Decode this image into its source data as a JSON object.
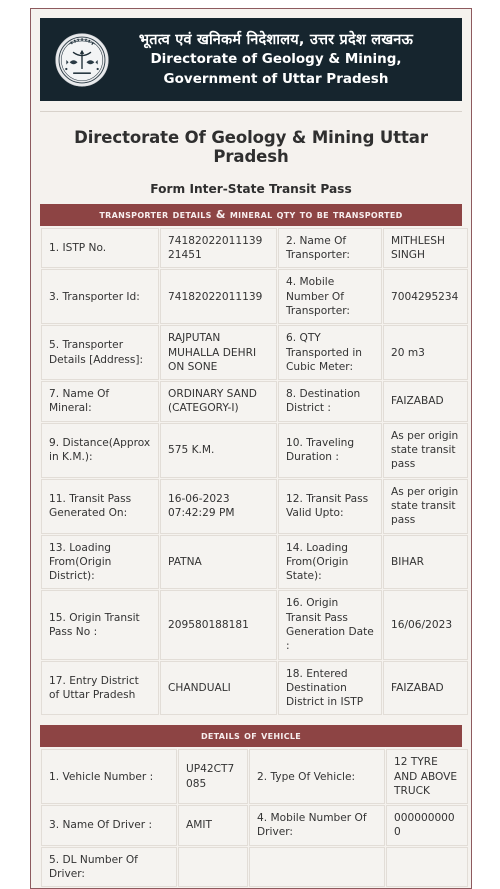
{
  "banner": {
    "emblem_icon": "uttar-pradesh-state-emblem-icon",
    "hindi_title": "भूतत्व एवं खनिकर्म निदेशालय, उत्तर प्रदेश लखनऊ",
    "english_line1": "Directorate of Geology & Mining,",
    "english_line2": "Government of Uttar Pradesh",
    "background_color": "#16252e"
  },
  "header": {
    "main_title": "Directorate Of Geology & Mining Uttar Pradesh",
    "sub_title": "Form Inter-State Transit Pass"
  },
  "colors": {
    "section_bar": "#8d4444",
    "card_border": "#8d5a5e",
    "card_background": "#f5f2ee",
    "cell_background": "#f5f3f0"
  },
  "transporter_section": {
    "bar_label": "Transporter Details & Mineral QTY to be Transported",
    "rows": [
      {
        "label_left": "1. ISTP No.",
        "value_left": "7418202201113921451",
        "label_right": "2. Name Of Transporter:",
        "value_right": "MITHLESH SINGH"
      },
      {
        "label_left": "3. Transporter Id:",
        "value_left": "74182022011139",
        "label_right": "4. Mobile Number Of Transporter:",
        "value_right": "7004295234"
      },
      {
        "label_left": "5. Transporter Details [Address]:",
        "value_left": "RAJPUTAN MUHALLA DEHRI ON SONE",
        "label_right": "6. QTY Transported in Cubic Meter:",
        "value_right": "20 m3"
      },
      {
        "label_left": "7. Name Of Mineral:",
        "value_left": "ORDINARY SAND (CATEGORY-I)",
        "label_right": "8. Destination District :",
        "value_right": "FAIZABAD"
      },
      {
        "label_left": "9. Distance(Approx in K.M.):",
        "value_left": "575 K.M.",
        "label_right": "10. Traveling Duration :",
        "value_right": "As per origin state transit pass"
      },
      {
        "label_left": "11. Transit Pass Generated On:",
        "value_left": "16-06-2023 07:42:29 PM",
        "label_right": "12. Transit Pass Valid Upto:",
        "value_right": "As per origin state transit pass"
      },
      {
        "label_left": "13. Loading From(Origin District):",
        "value_left": "PATNA",
        "label_right": "14. Loading From(Origin State):",
        "value_right": "BIHAR"
      },
      {
        "label_left": "15. Origin Transit Pass No :",
        "value_left": "209580188181",
        "label_right": "16. Origin Transit Pass Generation Date :",
        "value_right": "16/06/2023"
      },
      {
        "label_left": "17. Entry District of Uttar Pradesh",
        "value_left": "CHANDUALI",
        "label_right": "18. Entered Destination District in ISTP",
        "value_right": "FAIZABAD"
      }
    ]
  },
  "vehicle_section": {
    "bar_label": "Details Of Vehicle",
    "rows": [
      {
        "label_left": "1. Vehicle Number :",
        "value_left": "UP42CT7085",
        "label_right": "2. Type Of Vehicle:",
        "value_right": "12 TYRE AND ABOVE TRUCK"
      },
      {
        "label_left": "3. Name Of Driver :",
        "value_left": "AMIT",
        "label_right": "4. Mobile Number Of Driver:",
        "value_right": "0000000000"
      },
      {
        "label_left": "5. DL Number Of Driver:",
        "value_left": "",
        "label_right": "",
        "value_right": ""
      }
    ]
  }
}
